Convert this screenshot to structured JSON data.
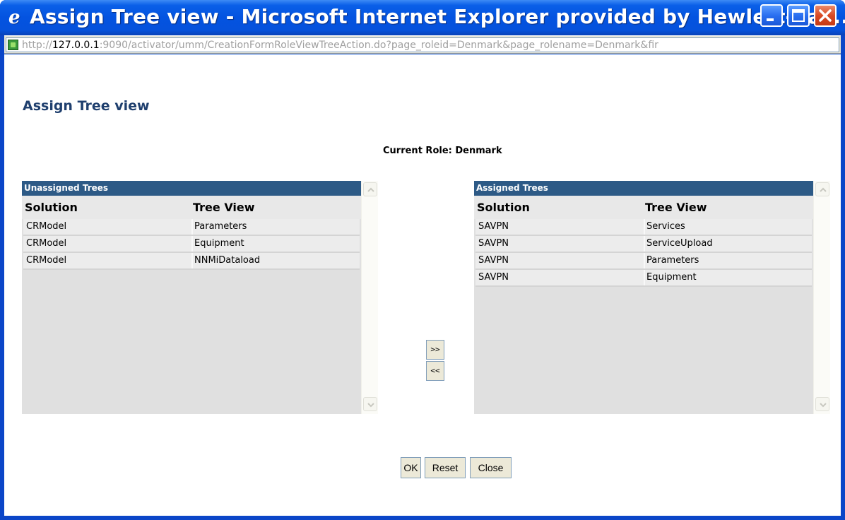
{
  "window": {
    "title": "Assign Tree view - Microsoft Internet Explorer provided by Hewlett-Pac...",
    "icon": "ie-icon",
    "controls": [
      "minimize-icon",
      "maximize-icon",
      "close-icon"
    ]
  },
  "address": {
    "prefix": "http://",
    "host": "127.0.0.1",
    "rest": ":9090/activator/umm/CreationFormRoleViewTreeAction.do?page_roleid=Denmark&page_rolename=Denmark&fir"
  },
  "page": {
    "title": "Assign Tree view",
    "current_role": "Current Role: Denmark"
  },
  "unassigned": {
    "header": "Unassigned Trees",
    "col_solution": "Solution",
    "col_treeview": "Tree View",
    "rows": [
      {
        "solution": "CRModel",
        "tree_view": "Parameters"
      },
      {
        "solution": "CRModel",
        "tree_view": "Equipment"
      },
      {
        "solution": "CRModel",
        "tree_view": "NNMiDataload"
      }
    ]
  },
  "assigned": {
    "header": "Assigned Trees",
    "col_solution": "Solution",
    "col_treeview": "Tree View",
    "rows": [
      {
        "solution": "SAVPN",
        "tree_view": "Services"
      },
      {
        "solution": "SAVPN",
        "tree_view": "ServiceUpload"
      },
      {
        "solution": "SAVPN",
        "tree_view": "Parameters"
      },
      {
        "solution": "SAVPN",
        "tree_view": "Equipment"
      }
    ]
  },
  "actions": {
    "add": ">>",
    "remove": "<<",
    "ok": "OK",
    "reset": "Reset",
    "close": "Close"
  },
  "colors": {
    "panel_header": "#2d5a86",
    "page_title": "#1f3f6e",
    "title_bar": "#0453e0"
  }
}
